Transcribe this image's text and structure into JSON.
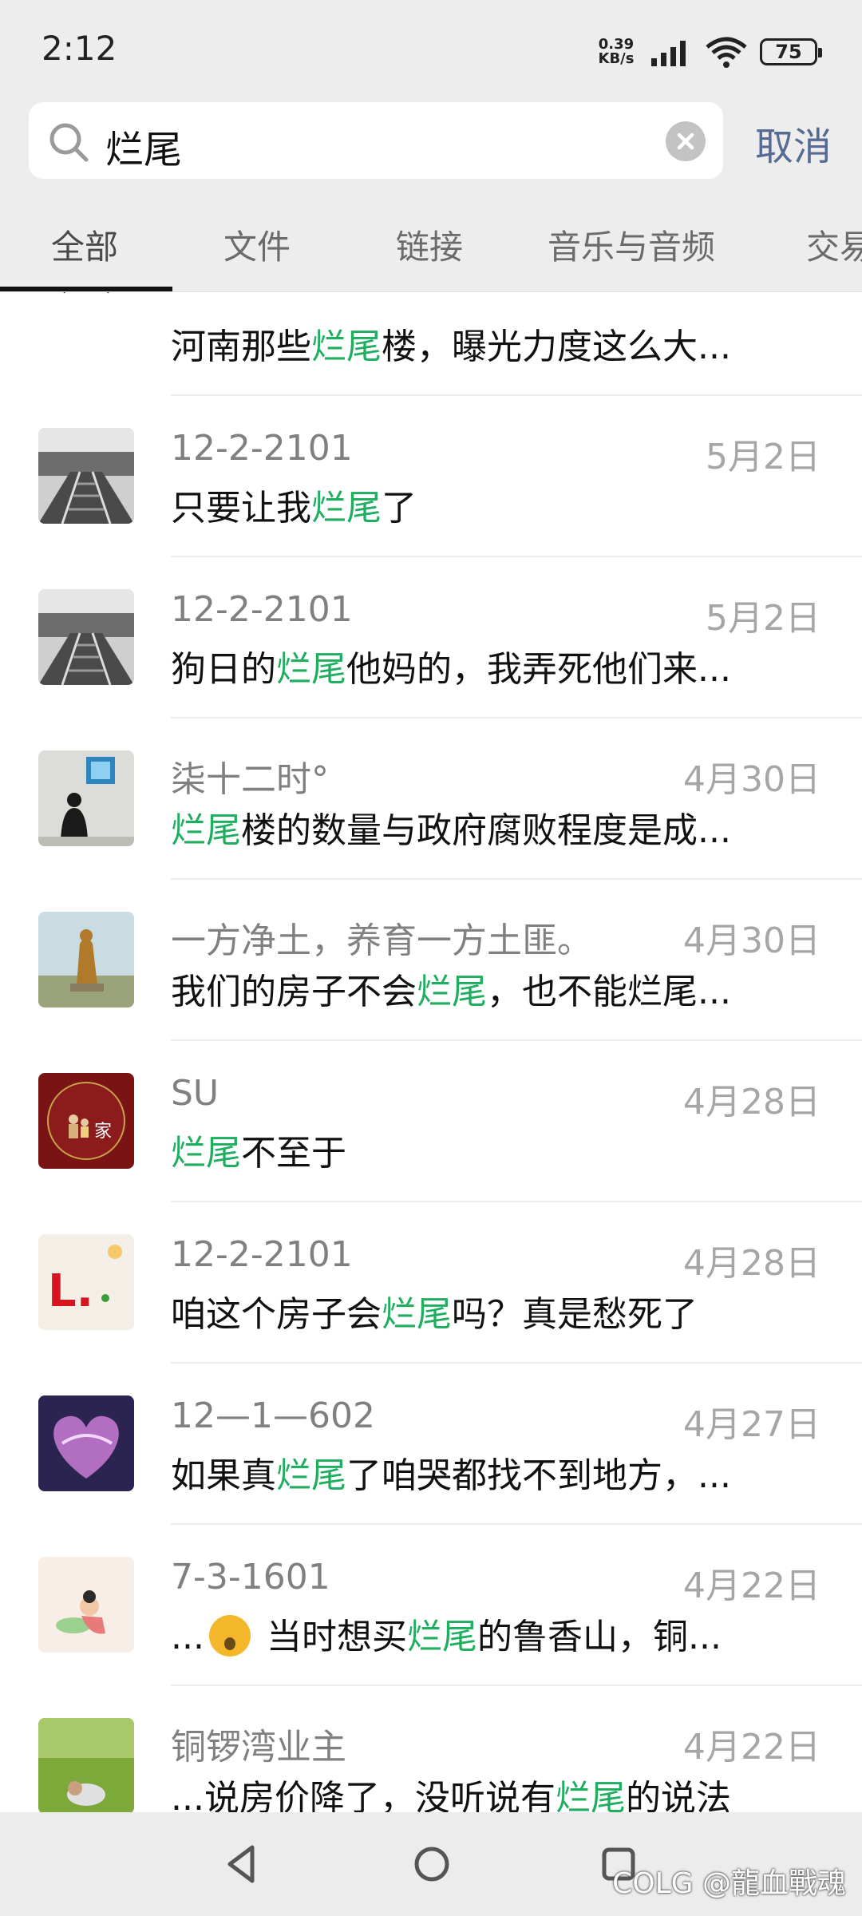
{
  "status_bar": {
    "time": "2:12",
    "net_speed_value": "0.39",
    "net_speed_unit": "KB/s",
    "battery": "75"
  },
  "search": {
    "query": "烂尾",
    "cancel_label": "取消"
  },
  "tabs": [
    {
      "label": "全部",
      "active": true
    },
    {
      "label": "文件",
      "active": false
    },
    {
      "label": "链接",
      "active": false
    },
    {
      "label": "音乐与音频",
      "active": false
    },
    {
      "label": "交易",
      "active": false
    }
  ],
  "results": [
    {
      "name": "",
      "date": "",
      "msg": [
        {
          "t": "河南那些"
        },
        {
          "t": "烂尾",
          "hl": true
        },
        {
          "t": "楼，曝光力度这么大..."
        }
      ],
      "avatar": "partial"
    },
    {
      "name": "12-2-2101",
      "date": "5月2日",
      "msg": [
        {
          "t": "只要让我"
        },
        {
          "t": "烂尾",
          "hl": true
        },
        {
          "t": "了"
        }
      ],
      "avatar": "railway"
    },
    {
      "name": "12-2-2101",
      "date": "5月2日",
      "msg": [
        {
          "t": "狗日的"
        },
        {
          "t": "烂尾",
          "hl": true
        },
        {
          "t": "他妈的，我弄死他们来..."
        }
      ],
      "avatar": "railway"
    },
    {
      "name": "柒十二时°",
      "date": "4月30日",
      "msg": [
        {
          "t": "烂尾",
          "hl": true
        },
        {
          "t": "楼的数量与政府腐败程度是成..."
        }
      ],
      "avatar": "gallery"
    },
    {
      "name": "一方净土，养育一方土匪。",
      "date": "4月30日",
      "msg": [
        {
          "t": "我们的房子不会"
        },
        {
          "t": "烂尾",
          "hl": true
        },
        {
          "t": "，也不能烂尾..."
        }
      ],
      "avatar": "statue"
    },
    {
      "name": "SU",
      "date": "4月28日",
      "msg": [
        {
          "t": "烂尾",
          "hl": true
        },
        {
          "t": "不至于"
        }
      ],
      "avatar": "family"
    },
    {
      "name": "12-2-2101",
      "date": "4月28日",
      "msg": [
        {
          "t": "咱这个房子会"
        },
        {
          "t": "烂尾",
          "hl": true
        },
        {
          "t": "吗？真是愁死了"
        }
      ],
      "avatar": "letter"
    },
    {
      "name": "12—1—602",
      "date": "4月27日",
      "msg": [
        {
          "t": "如果真"
        },
        {
          "t": "烂尾",
          "hl": true
        },
        {
          "t": "了咱哭都找不到地方，..."
        }
      ],
      "avatar": "heart"
    },
    {
      "name": "7-3-1601",
      "date": "4月22日",
      "msg": [
        {
          "t": "..."
        },
        {
          "emoji": true
        },
        {
          "t": " 当时想买"
        },
        {
          "t": "烂尾",
          "hl": true
        },
        {
          "t": "的鲁香山，铜..."
        }
      ],
      "avatar": "cartoon"
    },
    {
      "name": "铜锣湾业主",
      "date": "4月22日",
      "msg": [
        {
          "t": "...说房价降了，没听说有"
        },
        {
          "t": "烂尾",
          "hl": true
        },
        {
          "t": "的说法"
        }
      ],
      "avatar": "field"
    }
  ],
  "watermark": "@龍血戰魂",
  "watermark_brand": "COLG",
  "avatar_texts": {
    "family": "家",
    "letter": "L."
  },
  "colors": {
    "highlight": "#1fae5f",
    "cancel": "#566b94",
    "background": "#ededed"
  }
}
